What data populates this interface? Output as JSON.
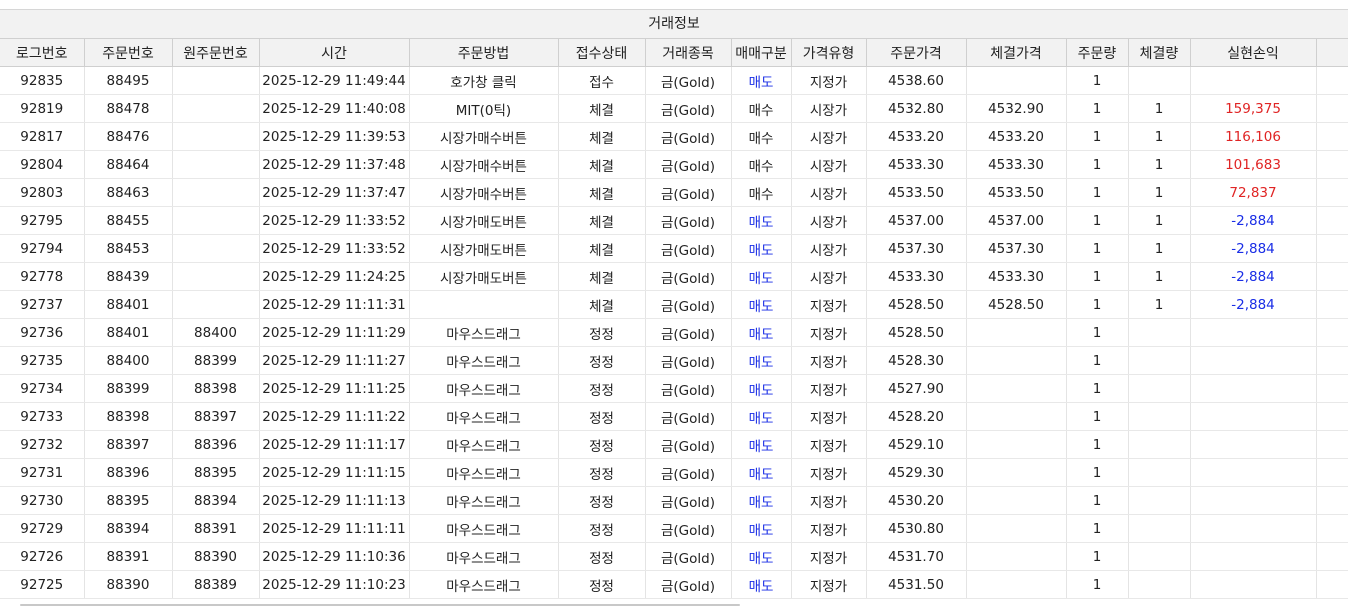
{
  "group_title": "거래정보",
  "columns": [
    "로그번호",
    "주문번호",
    "원주문번호",
    "시간",
    "주문방법",
    "접수상태",
    "거래종목",
    "매매구분",
    "가격유형",
    "주문가격",
    "체결가격",
    "주문량",
    "체결량",
    "실현손익",
    ""
  ],
  "rows": [
    {
      "log": "92835",
      "order": "88495",
      "orig": "",
      "time": "2025-12-29 11:49:44",
      "method": "호가창 클릭",
      "status": "접수",
      "item": "금(Gold)",
      "side": "매도",
      "side_type": "sell",
      "ptype": "지정가",
      "oprice": "4538.60",
      "fprice": "",
      "oqty": "1",
      "fqty": "",
      "pnl": "",
      "pnl_type": ""
    },
    {
      "log": "92819",
      "order": "88478",
      "orig": "",
      "time": "2025-12-29 11:40:08",
      "method": "MIT(0틱)",
      "status": "체결",
      "item": "금(Gold)",
      "side": "매수",
      "side_type": "buy",
      "ptype": "시장가",
      "oprice": "4532.80",
      "fprice": "4532.90",
      "oqty": "1",
      "fqty": "1",
      "pnl": "159,375",
      "pnl_type": "pos"
    },
    {
      "log": "92817",
      "order": "88476",
      "orig": "",
      "time": "2025-12-29 11:39:53",
      "method": "시장가매수버튼",
      "status": "체결",
      "item": "금(Gold)",
      "side": "매수",
      "side_type": "buy",
      "ptype": "시장가",
      "oprice": "4533.20",
      "fprice": "4533.20",
      "oqty": "1",
      "fqty": "1",
      "pnl": "116,106",
      "pnl_type": "pos"
    },
    {
      "log": "92804",
      "order": "88464",
      "orig": "",
      "time": "2025-12-29 11:37:48",
      "method": "시장가매수버튼",
      "status": "체결",
      "item": "금(Gold)",
      "side": "매수",
      "side_type": "buy",
      "ptype": "시장가",
      "oprice": "4533.30",
      "fprice": "4533.30",
      "oqty": "1",
      "fqty": "1",
      "pnl": "101,683",
      "pnl_type": "pos"
    },
    {
      "log": "92803",
      "order": "88463",
      "orig": "",
      "time": "2025-12-29 11:37:47",
      "method": "시장가매수버튼",
      "status": "체결",
      "item": "금(Gold)",
      "side": "매수",
      "side_type": "buy",
      "ptype": "시장가",
      "oprice": "4533.50",
      "fprice": "4533.50",
      "oqty": "1",
      "fqty": "1",
      "pnl": "72,837",
      "pnl_type": "pos"
    },
    {
      "log": "92795",
      "order": "88455",
      "orig": "",
      "time": "2025-12-29 11:33:52",
      "method": "시장가매도버튼",
      "status": "체결",
      "item": "금(Gold)",
      "side": "매도",
      "side_type": "sell",
      "ptype": "시장가",
      "oprice": "4537.00",
      "fprice": "4537.00",
      "oqty": "1",
      "fqty": "1",
      "pnl": "-2,884",
      "pnl_type": "neg"
    },
    {
      "log": "92794",
      "order": "88453",
      "orig": "",
      "time": "2025-12-29 11:33:52",
      "method": "시장가매도버튼",
      "status": "체결",
      "item": "금(Gold)",
      "side": "매도",
      "side_type": "sell",
      "ptype": "시장가",
      "oprice": "4537.30",
      "fprice": "4537.30",
      "oqty": "1",
      "fqty": "1",
      "pnl": "-2,884",
      "pnl_type": "neg"
    },
    {
      "log": "92778",
      "order": "88439",
      "orig": "",
      "time": "2025-12-29 11:24:25",
      "method": "시장가매도버튼",
      "status": "체결",
      "item": "금(Gold)",
      "side": "매도",
      "side_type": "sell",
      "ptype": "시장가",
      "oprice": "4533.30",
      "fprice": "4533.30",
      "oqty": "1",
      "fqty": "1",
      "pnl": "-2,884",
      "pnl_type": "neg"
    },
    {
      "log": "92737",
      "order": "88401",
      "orig": "",
      "time": "2025-12-29 11:11:31",
      "method": "",
      "status": "체결",
      "item": "금(Gold)",
      "side": "매도",
      "side_type": "sell",
      "ptype": "지정가",
      "oprice": "4528.50",
      "fprice": "4528.50",
      "oqty": "1",
      "fqty": "1",
      "pnl": "-2,884",
      "pnl_type": "neg"
    },
    {
      "log": "92736",
      "order": "88401",
      "orig": "88400",
      "time": "2025-12-29 11:11:29",
      "method": "마우스드래그",
      "status": "정정",
      "item": "금(Gold)",
      "side": "매도",
      "side_type": "sell",
      "ptype": "지정가",
      "oprice": "4528.50",
      "fprice": "",
      "oqty": "1",
      "fqty": "",
      "pnl": "",
      "pnl_type": ""
    },
    {
      "log": "92735",
      "order": "88400",
      "orig": "88399",
      "time": "2025-12-29 11:11:27",
      "method": "마우스드래그",
      "status": "정정",
      "item": "금(Gold)",
      "side": "매도",
      "side_type": "sell",
      "ptype": "지정가",
      "oprice": "4528.30",
      "fprice": "",
      "oqty": "1",
      "fqty": "",
      "pnl": "",
      "pnl_type": ""
    },
    {
      "log": "92734",
      "order": "88399",
      "orig": "88398",
      "time": "2025-12-29 11:11:25",
      "method": "마우스드래그",
      "status": "정정",
      "item": "금(Gold)",
      "side": "매도",
      "side_type": "sell",
      "ptype": "지정가",
      "oprice": "4527.90",
      "fprice": "",
      "oqty": "1",
      "fqty": "",
      "pnl": "",
      "pnl_type": ""
    },
    {
      "log": "92733",
      "order": "88398",
      "orig": "88397",
      "time": "2025-12-29 11:11:22",
      "method": "마우스드래그",
      "status": "정정",
      "item": "금(Gold)",
      "side": "매도",
      "side_type": "sell",
      "ptype": "지정가",
      "oprice": "4528.20",
      "fprice": "",
      "oqty": "1",
      "fqty": "",
      "pnl": "",
      "pnl_type": ""
    },
    {
      "log": "92732",
      "order": "88397",
      "orig": "88396",
      "time": "2025-12-29 11:11:17",
      "method": "마우스드래그",
      "status": "정정",
      "item": "금(Gold)",
      "side": "매도",
      "side_type": "sell",
      "ptype": "지정가",
      "oprice": "4529.10",
      "fprice": "",
      "oqty": "1",
      "fqty": "",
      "pnl": "",
      "pnl_type": ""
    },
    {
      "log": "92731",
      "order": "88396",
      "orig": "88395",
      "time": "2025-12-29 11:11:15",
      "method": "마우스드래그",
      "status": "정정",
      "item": "금(Gold)",
      "side": "매도",
      "side_type": "sell",
      "ptype": "지정가",
      "oprice": "4529.30",
      "fprice": "",
      "oqty": "1",
      "fqty": "",
      "pnl": "",
      "pnl_type": ""
    },
    {
      "log": "92730",
      "order": "88395",
      "orig": "88394",
      "time": "2025-12-29 11:11:13",
      "method": "마우스드래그",
      "status": "정정",
      "item": "금(Gold)",
      "side": "매도",
      "side_type": "sell",
      "ptype": "지정가",
      "oprice": "4530.20",
      "fprice": "",
      "oqty": "1",
      "fqty": "",
      "pnl": "",
      "pnl_type": ""
    },
    {
      "log": "92729",
      "order": "88394",
      "orig": "88391",
      "time": "2025-12-29 11:11:11",
      "method": "마우스드래그",
      "status": "정정",
      "item": "금(Gold)",
      "side": "매도",
      "side_type": "sell",
      "ptype": "지정가",
      "oprice": "4530.80",
      "fprice": "",
      "oqty": "1",
      "fqty": "",
      "pnl": "",
      "pnl_type": ""
    },
    {
      "log": "92726",
      "order": "88391",
      "orig": "88390",
      "time": "2025-12-29 11:10:36",
      "method": "마우스드래그",
      "status": "정정",
      "item": "금(Gold)",
      "side": "매도",
      "side_type": "sell",
      "ptype": "지정가",
      "oprice": "4531.70",
      "fprice": "",
      "oqty": "1",
      "fqty": "",
      "pnl": "",
      "pnl_type": ""
    },
    {
      "log": "92725",
      "order": "88390",
      "orig": "88389",
      "time": "2025-12-29 11:10:23",
      "method": "마우스드래그",
      "status": "정정",
      "item": "금(Gold)",
      "side": "매도",
      "side_type": "sell",
      "ptype": "지정가",
      "oprice": "4531.50",
      "fprice": "",
      "oqty": "1",
      "fqty": "",
      "pnl": "",
      "pnl_type": ""
    }
  ],
  "colors": {
    "sell": "#1a2ee6",
    "profit": "#e02424",
    "loss": "#1a2ee6",
    "header_bg": "#f2f2f2"
  }
}
